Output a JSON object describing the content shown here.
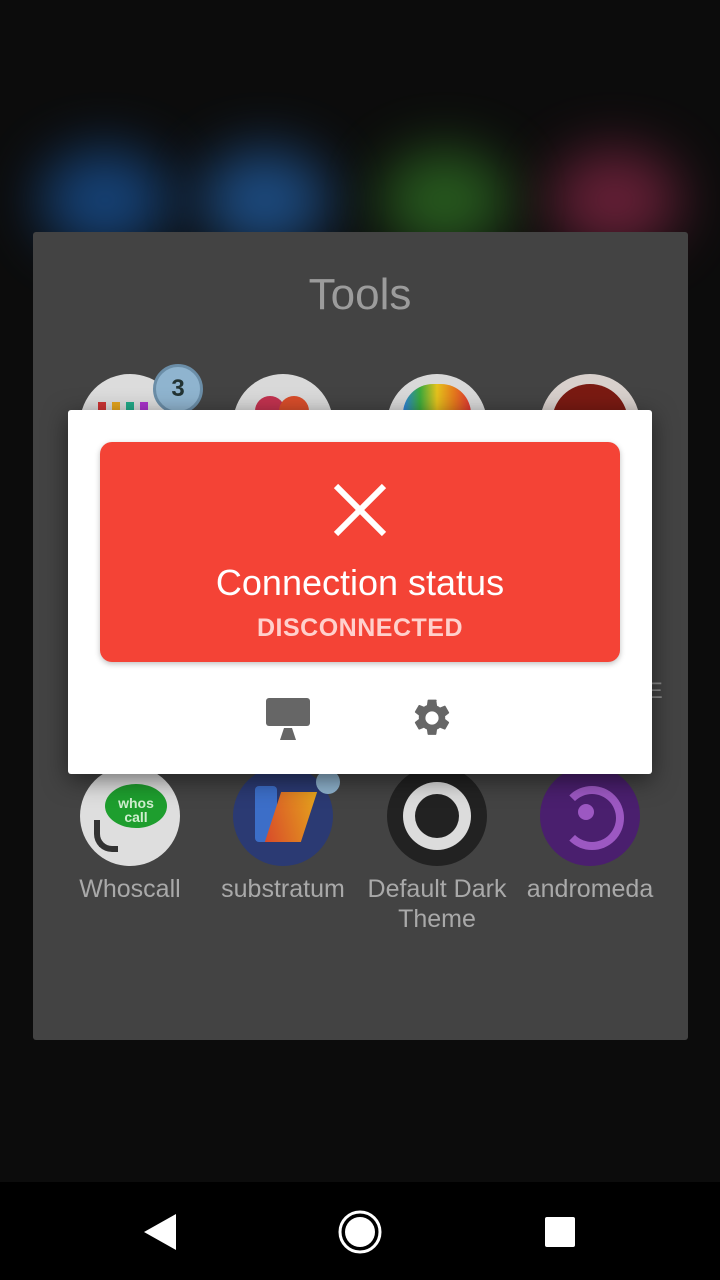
{
  "folder": {
    "title": "Tools",
    "apps": [
      {
        "label": "Whoscall",
        "icon": "whoscall-icon",
        "icon_text": "whos call"
      },
      {
        "label": "substratum",
        "icon": "substratum-icon"
      },
      {
        "label": "Default Dark Theme",
        "icon": "default-dark-theme-icon"
      },
      {
        "label": "andromeda",
        "icon": "andromeda-icon"
      }
    ],
    "top_row_badge": "3"
  },
  "dialog": {
    "status_title": "Connection status",
    "status_value": "DISCONNECTED",
    "status_color": "#f44336",
    "buttons": [
      {
        "icon": "desktop-icon"
      },
      {
        "icon": "settings-gear-icon"
      }
    ]
  },
  "navbar": {
    "buttons": [
      "back-icon",
      "home-icon",
      "recents-icon"
    ]
  }
}
